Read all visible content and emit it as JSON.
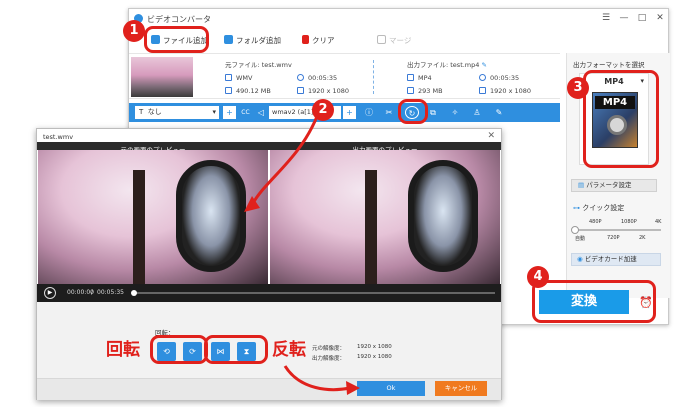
{
  "main_window": {
    "title": "ビデオコンバータ",
    "window_controls": [
      "☰",
      "—",
      "□",
      "✕"
    ],
    "toolbar": {
      "add_file": "ファイル追加",
      "add_folder": "フォルダ追加",
      "clear": "クリア",
      "merge": "マージ"
    },
    "source": {
      "label": "元ファイル: test.wmv",
      "format": "WMV",
      "duration": "00:05:35",
      "size": "490.12 MB",
      "resolution": "1920 x 1080"
    },
    "output": {
      "label": "出力ファイル: test.mp4",
      "format": "MP4",
      "duration": "00:05:35",
      "size": "293 MB",
      "resolution": "1920 x 1080"
    },
    "edit_bar": {
      "subtitle_value": "なし",
      "audio_value": "wmav2 (a[1]"
    },
    "right_panel": {
      "heading": "出力フォーマットを選択",
      "format_name": "MP4",
      "format_icon_text": "MP4",
      "param_button": "パラメータ設定",
      "quick_setting": "クイック設定",
      "slider_labels": [
        "480P",
        "1080P",
        "4K"
      ],
      "slider_labels_bottom": [
        "自動",
        "720P",
        "2K"
      ],
      "gpu_label": "ビデオカード加速",
      "convert_button": "変換"
    }
  },
  "dialog": {
    "title": "test.wmv",
    "original_preview_label": "元の画面のプレビュー",
    "output_preview_label": "出力画面のプレビュー",
    "time_current": "00:00:00",
    "time_separator": "/",
    "time_total": "00:05:35",
    "rotate_label": "回転：",
    "orig_res_label": "元の解像度：",
    "orig_res_value": "1920 x 1080",
    "out_res_label": "出力解像度：",
    "out_res_value": "1920 x 1080",
    "ok_button": "Ok",
    "cancel_button": "キャンセル"
  },
  "annotations": {
    "badges": [
      "1",
      "2",
      "3",
      "4"
    ],
    "rotate_text": "回転",
    "flip_text": "反転"
  },
  "colors": {
    "accent": "#2f8fdf",
    "callout": "#e0211c",
    "cancel": "#f07a1f",
    "convert": "#1a9be8"
  }
}
